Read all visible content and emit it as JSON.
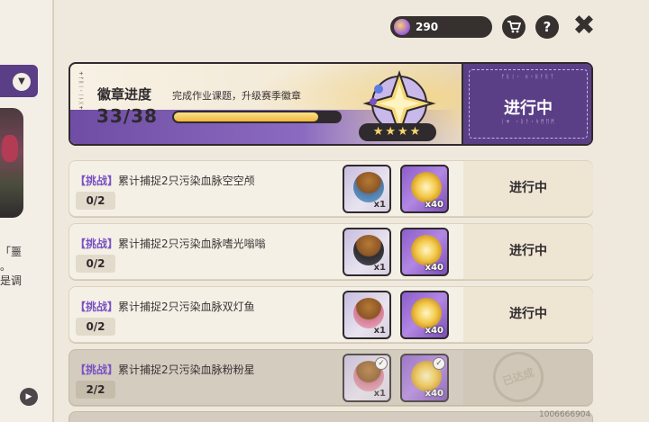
{
  "left_panel": {
    "text_lines": [
      "「噩",
      "。",
      "是调"
    ]
  },
  "topbar": {
    "currency_value": "290",
    "cart_icon": "cart-icon",
    "help_icon": "help-icon",
    "close_icon": "close-icon"
  },
  "banner": {
    "title": "徽章进度",
    "subtitle": "完成作业课题，升级赛季徽章",
    "count": "33/38",
    "progress": 0.868,
    "stars": "★★★★",
    "status_text": "进行中",
    "status_deco_top": "ᚠᚱᛁᚲ ᛟᚲᚺᚨᚱᛏ",
    "status_deco_bottom": "ᛁ+ ᚲᚱᚨᚲᛋᛗᛖᛗ",
    "side_deco": "+ᚠᚱᛁᚲᛁᚾᚷ+"
  },
  "quests": [
    {
      "tag": "【挑战】",
      "title": "累计捕捉2只污染血脉空空颅",
      "progress": "0/2",
      "reward_a_qty": "x1",
      "reward_b_qty": "x40",
      "status": "进行中",
      "done": false
    },
    {
      "tag": "【挑战】",
      "title": "累计捕捉2只污染血脉嗜光嗡嗡",
      "progress": "0/2",
      "reward_a_qty": "x1",
      "reward_b_qty": "x40",
      "status": "进行中",
      "done": false
    },
    {
      "tag": "【挑战】",
      "title": "累计捕捉2只污染血脉双灯鱼",
      "progress": "0/2",
      "reward_a_qty": "x1",
      "reward_b_qty": "x40",
      "status": "进行中",
      "done": false
    },
    {
      "tag": "【挑战】",
      "title": "累计捕捉2只污染血脉粉粉星",
      "progress": "2/2",
      "reward_a_qty": "x1",
      "reward_b_qty": "x40",
      "status": "已达成",
      "done": true
    }
  ],
  "uid": "1006666904"
}
